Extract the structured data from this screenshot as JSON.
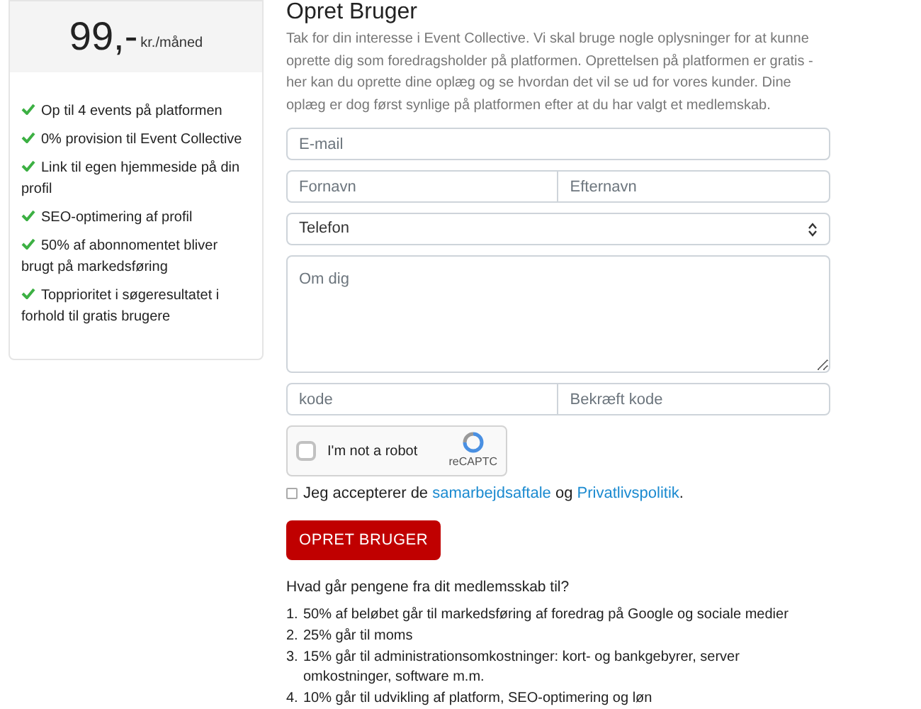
{
  "plan": {
    "price": "99,-",
    "unit": "kr./måned",
    "features": [
      "Op til 4 events på platformen",
      "0% provision til Event Collective",
      "Link til egen hjemmeside på din profil",
      "SEO-optimering af profil",
      "50% af abonnomentet bliver brugt på markedsføring",
      "Topprioritet i søgeresultatet i forhold til gratis brugere"
    ]
  },
  "form": {
    "title": "Opret Bruger",
    "intro": "Tak for din interesse i Event Collective. Vi skal bruge nogle oplysninger for at kunne oprette dig som foredragsholder på platformen. Oprettelsen på platformen er gratis - her kan du oprette dine oplæg og se hvordan det vil se ud for vores kunder. Dine oplæg er dog først synlige på platformen efter at du har valgt et medlemskab.",
    "rows": [
      {
        "kind": "single",
        "fields": [
          {
            "placeholder": "E-mail"
          }
        ]
      },
      {
        "kind": "pair",
        "fields": [
          {
            "placeholder": "Fornavn"
          },
          {
            "placeholder": "Efternavn"
          }
        ]
      },
      {
        "kind": "select",
        "fields": [
          {
            "placeholder": "Telefon"
          }
        ]
      },
      {
        "kind": "textarea",
        "fields": [
          {
            "placeholder": "Om dig"
          }
        ]
      },
      {
        "kind": "pair",
        "fields": [
          {
            "placeholder": "kode"
          },
          {
            "placeholder": "Bekræft kode"
          }
        ]
      }
    ],
    "captcha": {
      "label": "I'm not a robot",
      "brand": "reCAPTC",
      "checked": false
    },
    "terms": {
      "checked": false,
      "before": "Jeg accepterer de",
      "link1": "samarbejdsaftale",
      "middle": "og",
      "link2": "Privatlivspolitik",
      "after": "."
    },
    "submit": "OPRET BRUGER"
  },
  "info": {
    "heading": "Hvad går pengene fra dit medlemsskab til?",
    "items": [
      {
        "number": "1.",
        "text": "50% af beløbet går til markedsføring af foredrag på Google og sociale medier"
      },
      {
        "number": "2.",
        "text": "25% går til moms"
      },
      {
        "number": "3.",
        "text": "15% går til administrationsomkostninger: kort- og bankgebyrer, server omkostninger, software m.m."
      },
      {
        "number": "4.",
        "text": "10% går til udvikling af platform, SEO-optimering og løn"
      }
    ]
  }
}
